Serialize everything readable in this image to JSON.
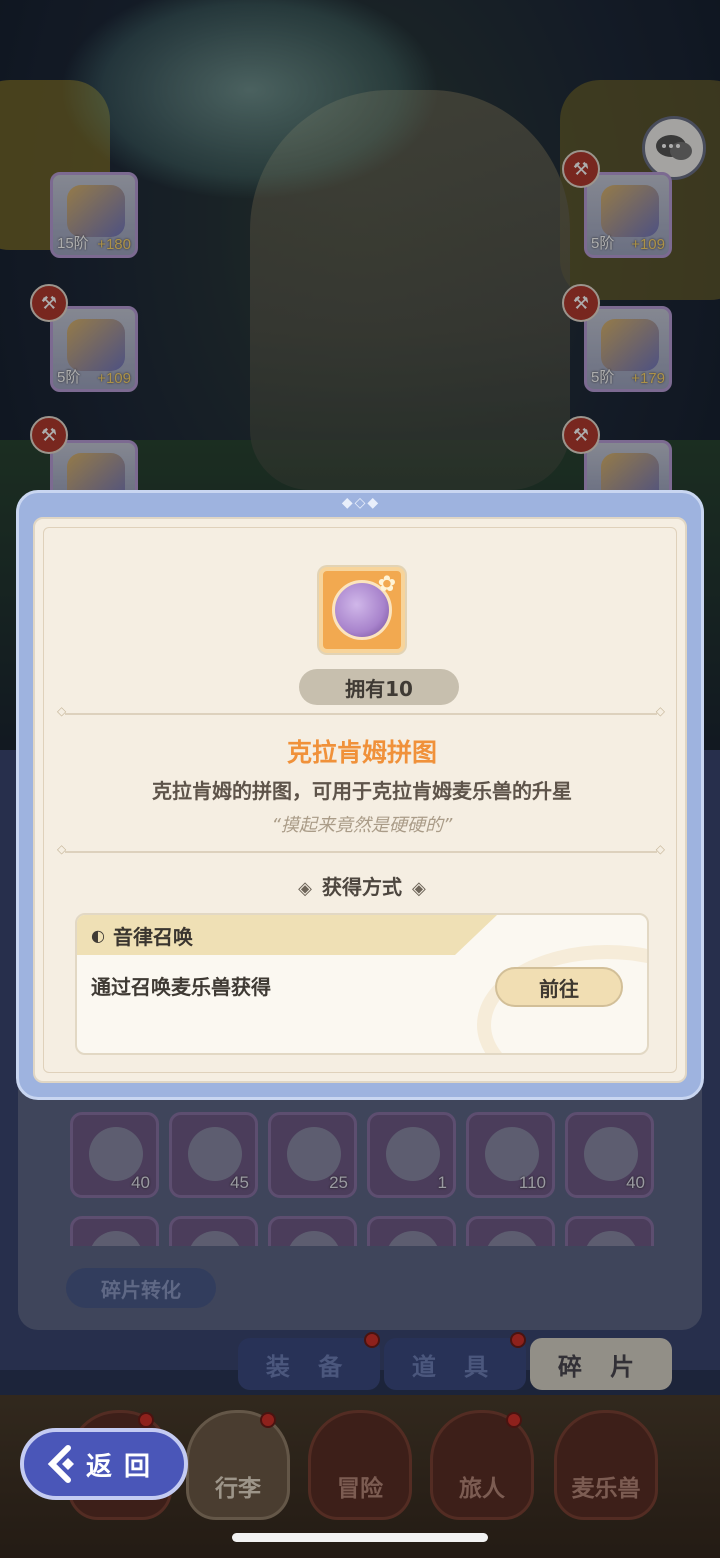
{
  "equipment": {
    "slots": [
      {
        "lvl": "15阶",
        "plus": "+180"
      },
      {
        "lvl": "5阶",
        "plus": "+109"
      },
      {
        "lvl": "5阶",
        "plus": "+109"
      },
      {
        "lvl": "5阶",
        "plus": "+179"
      }
    ]
  },
  "shards": {
    "counts": [
      "40",
      "45",
      "25",
      "1",
      "110",
      "40"
    ],
    "convert_label": "碎片转化"
  },
  "category_tabs": [
    "装 备",
    "道 具",
    "碎 片"
  ],
  "bottom_nav": [
    "行李",
    "冒险",
    "旅人",
    "麦乐兽"
  ],
  "back_button": {
    "label": "返回"
  },
  "dialog": {
    "owned": "拥有10",
    "title": "克拉肯姆拼图",
    "description": "克拉肯姆的拼图，可用于克拉肯姆麦乐兽的升星",
    "quote": "“摸起来竟然是硬硬的”",
    "source_header": "获得方式",
    "source": {
      "name": "音律召唤",
      "how": "通过召唤麦乐兽获得",
      "go_label": "前往"
    }
  },
  "colors": {
    "title_orange": "#f0913a",
    "dialog_border": "#9eb3df",
    "card_bg": "#f5eee2",
    "active_tab": "#d8d3c8"
  },
  "icons": {
    "chat": "chat-bubbles-icon",
    "hammer": "hammer-icon",
    "source": "music-note-icon",
    "back": "back-arrow-icon"
  }
}
